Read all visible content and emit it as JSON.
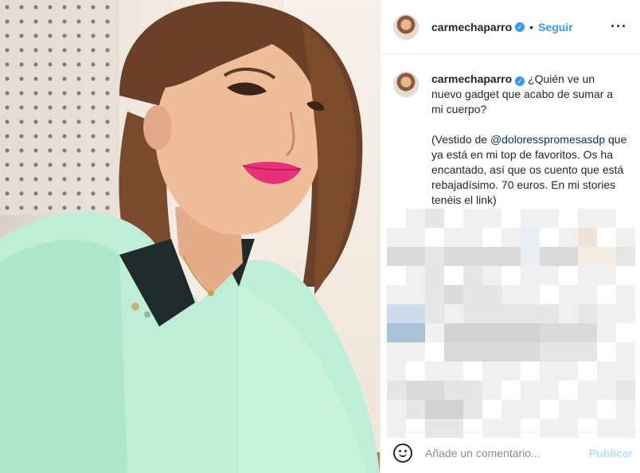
{
  "post": {
    "image_alt": "Foto de carmechaparro",
    "username": "carmechaparro",
    "verified_icon": "verified-badge-icon",
    "separator": "•",
    "follow_label": "Seguir",
    "more_icon": "more-options-icon"
  },
  "caption": {
    "username": "carmechaparro",
    "line1": " ¿Quién ve un nuevo gadget que acabo de sumar a mi cuerpo?",
    "part1": "(Vestido de ",
    "mention": "@doloresspromesasdp",
    "part2": " que ya está en mi top de favoritos. Os ha encantado, así que os cuento que está rebajadísimo. 70 euros. En mi stories tenéis el link)"
  },
  "footer": {
    "emoji_icon": "emoji-icon",
    "comment_placeholder": "Añade un comentario...",
    "publish_label": "Publicar"
  },
  "colors": {
    "accent": "#3897f0",
    "publish_disabled": "#b2dffc",
    "blur_tones": [
      "#f0f0f0",
      "#e6e6e6",
      "#dadada",
      "#d2d2d2",
      "#e9eef4",
      "#f5eee5",
      "#a9c2d9",
      "#cfdbe8",
      "#f1e4d4"
    ]
  }
}
